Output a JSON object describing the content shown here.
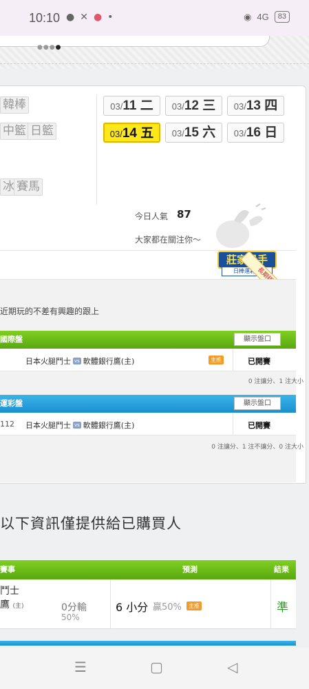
{
  "status_bar": {
    "time": "10:10",
    "battery": "83",
    "signal": "4G"
  },
  "sports": [
    {
      "label": "韓棒"
    },
    {
      "label": "中籃"
    },
    {
      "label": "日籃"
    },
    {
      "label": "冰"
    },
    {
      "label": "賽馬"
    }
  ],
  "dates": [
    {
      "date": "03/",
      "day": "11 二",
      "active": false
    },
    {
      "date": "03/",
      "day": "12 三",
      "active": false
    },
    {
      "date": "03/",
      "day": "13 四",
      "active": false
    },
    {
      "date": "03/",
      "day": "14 五",
      "active": true
    },
    {
      "date": "03/",
      "day": "15 六",
      "active": false
    },
    {
      "date": "03/",
      "day": "16 日",
      "active": false
    }
  ],
  "popularity": {
    "label": "今日人氣",
    "value": "87",
    "note": "大家都在關注你～"
  },
  "badge": {
    "title": "莊家殺手",
    "subtitle": "日棒運彩盤",
    "ribbon": "長期穩定"
  },
  "intro_text": "近期玩的不差有興趣的跟上",
  "sections": [
    {
      "title": "國際盤",
      "show_button": "顯示盤口",
      "id": "",
      "home": "日本火腿鬥士",
      "vs": "vs",
      "away": "軟體銀行鷹(主)",
      "tag": "主推",
      "status": "已開賽",
      "stats": "0 注讓分、1 注大小"
    },
    {
      "title": "運彩盤",
      "show_button": "顯示盤口",
      "id": "112",
      "home": "日本火腿鬥士",
      "vs": "vs",
      "away": "軟體銀行鷹(主)",
      "tag": "",
      "status": "已開賽",
      "stats": "0 注讓分、1 注不讓分、0 注大小"
    }
  ],
  "info_title": "以下資訊僅提供給已購買人",
  "table": {
    "headers": {
      "event": "賽事",
      "prediction": "預測",
      "result": "結果"
    },
    "row": {
      "team1": "鬥士",
      "team2": "鷹",
      "team2_suffix": "(主)",
      "odds1": "0分輸",
      "odds2": "50%",
      "prediction": "6 小分",
      "win": "贏50%",
      "tag": "主推",
      "result": "準"
    }
  },
  "nav": {
    "menu": "☰",
    "home": "▢",
    "back": "◁"
  }
}
